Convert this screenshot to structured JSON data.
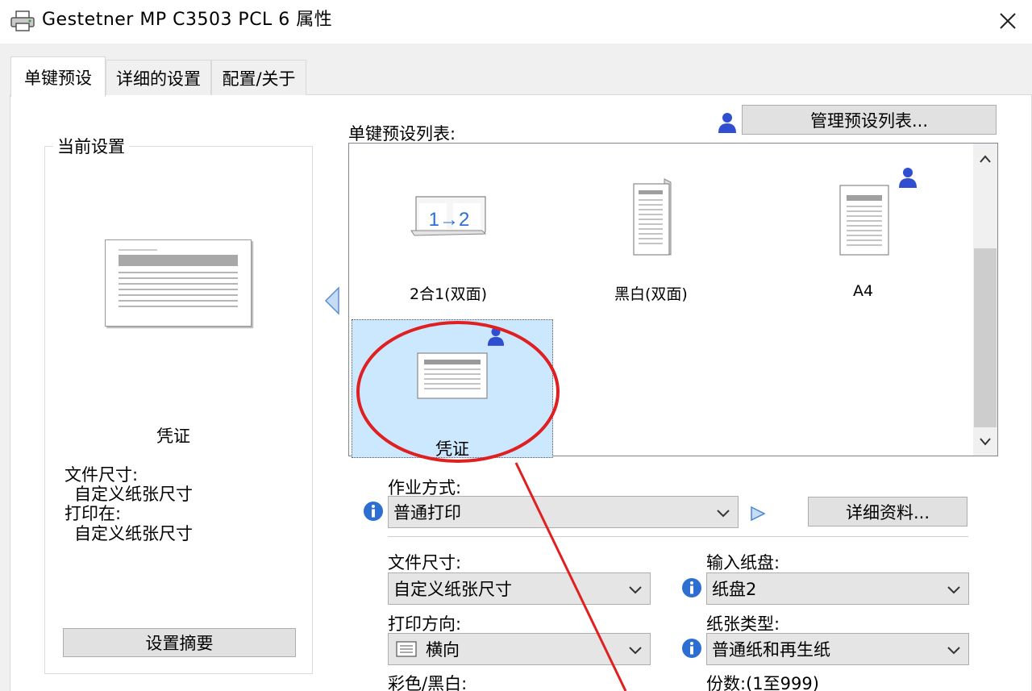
{
  "window": {
    "title": "Gestetner MP C3503 PCL 6 属性"
  },
  "tabs": [
    {
      "label": "单键预设"
    },
    {
      "label": "详细的设置"
    },
    {
      "label": "配置/关于"
    }
  ],
  "current_settings": {
    "legend": "当前设置",
    "preset_name": "凭证",
    "doc_size_label": "文件尺寸:",
    "doc_size_value": "自定义纸张尺寸",
    "print_on_label": "打印在:",
    "print_on_value": "自定义纸张尺寸",
    "summary_button": "设置摘要"
  },
  "preset_list": {
    "label": "单键预设列表:",
    "manage_button": "管理预设列表...",
    "items": [
      {
        "label": "2合1(双面)",
        "icon": "two-in-one-duplex-icon"
      },
      {
        "label": "黑白(双面)",
        "icon": "bw-duplex-icon"
      },
      {
        "label": "A4",
        "icon": "a4-page-icon"
      },
      {
        "label": "凭证",
        "icon": "voucher-landscape-icon",
        "selected": true
      }
    ],
    "two_in_one_text": "1→2"
  },
  "form": {
    "job_type_label": "作业方式:",
    "job_type_value": "普通打印",
    "details_button": "详细资料...",
    "doc_size_label": "文件尺寸:",
    "doc_size_value": "自定义纸张尺寸",
    "input_tray_label": "输入纸盘:",
    "input_tray_value": "纸盘2",
    "orientation_label": "打印方向:",
    "orientation_value": "横向",
    "paper_type_label": "纸张类型:",
    "paper_type_value": "普通纸和再生纸",
    "color_label": "彩色/黑白:",
    "copies_label": "份数:(1至999)"
  },
  "colors": {
    "accent_blue": "#3b6fd8",
    "annotation_red": "#e02020",
    "selection": "#cce8ff"
  }
}
